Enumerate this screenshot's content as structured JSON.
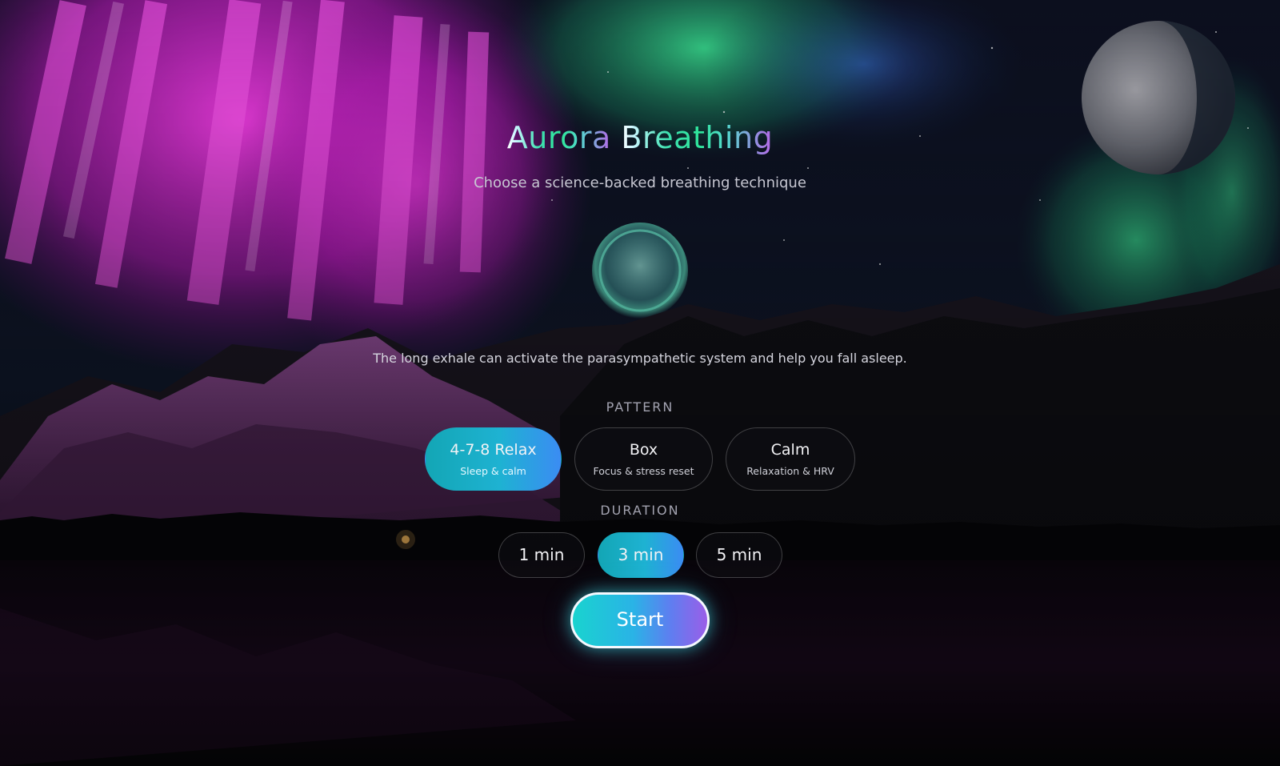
{
  "app": {
    "title_part1": "Aurora",
    "title_part2": "Breathing",
    "subtitle": "Choose a science-backed breathing technique"
  },
  "description": "The long exhale can activate the parasympathetic system and help you fall asleep.",
  "pattern": {
    "label": "PATTERN",
    "options": [
      {
        "name": "4-7-8 Relax",
        "sub": "Sleep & calm",
        "selected": true
      },
      {
        "name": "Box",
        "sub": "Focus & stress reset",
        "selected": false
      },
      {
        "name": "Calm",
        "sub": "Relaxation & HRV",
        "selected": false
      }
    ]
  },
  "duration": {
    "label": "DURATION",
    "options": [
      {
        "label": "1 min",
        "selected": false
      },
      {
        "label": "3 min",
        "selected": true
      },
      {
        "label": "5 min",
        "selected": false
      }
    ]
  },
  "start_label": "Start",
  "colors": {
    "accent_teal": "#13a6b5",
    "accent_blue": "#3b8cf3",
    "accent_purple": "#9a5ee8",
    "aurora_pink": "#d21ed0",
    "aurora_green": "#2ee59a"
  }
}
